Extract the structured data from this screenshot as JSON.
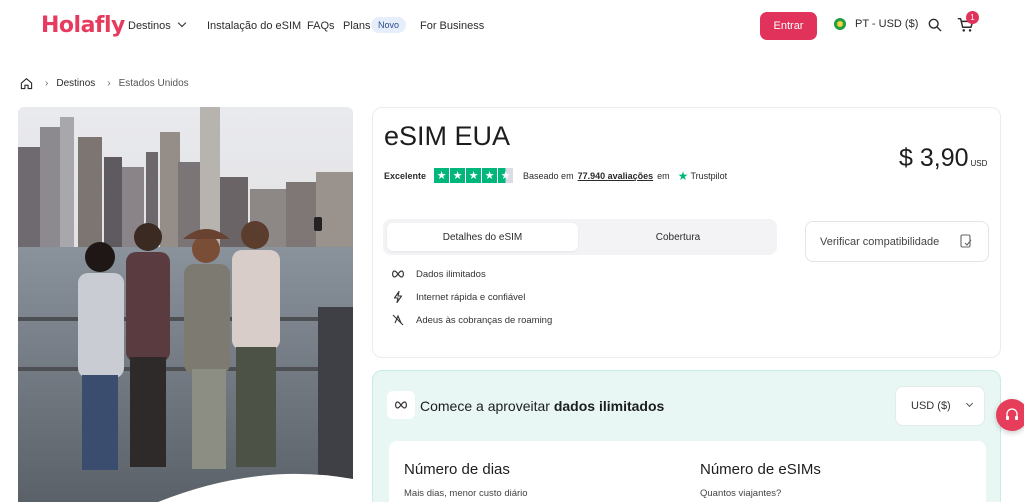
{
  "nav": {
    "logo": "Holafly",
    "destinos": "Destinos",
    "instalacao": "Instalação do eSIM",
    "faqs": "FAQs",
    "plans": "Plans",
    "novo_badge": "Novo",
    "business": "For Business",
    "entrar": "Entrar",
    "language_currency": "PT - USD ($)",
    "cart_count": "1"
  },
  "breadcrumb": {
    "home_icon": "home-icon",
    "destinos": "Destinos",
    "current": "Estados Unidos"
  },
  "product": {
    "title": "eSIM EUA",
    "rating_label": "Excelente",
    "stars": 4.5,
    "based_on": "Baseado em",
    "reviews_count": "77.940 avaliações",
    "on": "em",
    "trustpilot": "Trustpilot",
    "price": "$ 3,90",
    "price_currency": "USD",
    "tabs": [
      {
        "label": "Detalhes do eSIM",
        "active": true
      },
      {
        "label": "Cobertura",
        "active": false
      }
    ],
    "verify_button": "Verificar compatibilidade",
    "features": [
      {
        "icon": "infinity-icon",
        "label": "Dados ilimitados"
      },
      {
        "icon": "lightning-icon",
        "label": "Internet rápida e confiável"
      },
      {
        "icon": "no-roaming-icon",
        "label": "Adeus às cobranças de roaming"
      }
    ]
  },
  "plan_panel": {
    "title_prefix": "Comece a aproveitar",
    "title_bold": "dados ilimitados",
    "currency": "USD ($)",
    "days_heading": "Número de dias",
    "days_sub": "Mais dias, menor custo diário",
    "esims_heading": "Número de eSIMs",
    "esims_sub": "Quantos viajantes?"
  },
  "colors": {
    "brand": "#e0325a",
    "trustpilot_green": "#00b67a",
    "panel_bg": "#e8f6f4"
  }
}
